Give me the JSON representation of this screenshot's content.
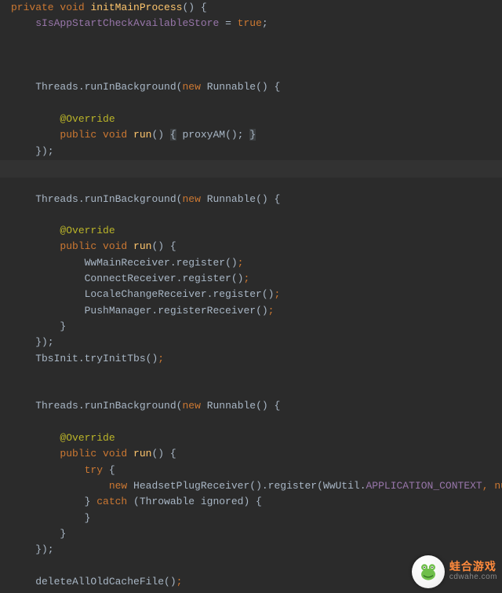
{
  "code_lines": [
    [
      {
        "t": "private ",
        "c": "kw"
      },
      {
        "t": "void ",
        "c": "kw"
      },
      {
        "t": "initMainProcess",
        "c": "meth"
      },
      {
        "t": "() {",
        "c": ""
      }
    ],
    [
      {
        "t": "    ",
        "c": ""
      },
      {
        "t": "sIsAppStartCheckAvailableStore",
        "c": "st"
      },
      {
        "t": " = ",
        "c": ""
      },
      {
        "t": "true",
        "c": "lit"
      },
      {
        "t": ";",
        "c": ""
      }
    ],
    [],
    [],
    [],
    [
      {
        "t": "    Threads.",
        "c": ""
      },
      {
        "t": "runInBackground",
        "c": ""
      },
      {
        "t": "(",
        "c": ""
      },
      {
        "t": "new ",
        "c": "kw"
      },
      {
        "t": "Runnable() {",
        "c": ""
      }
    ],
    [],
    [
      {
        "t": "        ",
        "c": ""
      },
      {
        "t": "@Override",
        "c": "ann"
      }
    ],
    [
      {
        "t": "        ",
        "c": ""
      },
      {
        "t": "public ",
        "c": "kw"
      },
      {
        "t": "void ",
        "c": "kw"
      },
      {
        "t": "run",
        "c": "meth"
      },
      {
        "t": "() ",
        "c": ""
      },
      {
        "t": "{",
        "c": "hl"
      },
      {
        "t": " proxyAM(); ",
        "c": ""
      },
      {
        "t": "}",
        "c": "hl"
      }
    ],
    [
      {
        "t": "    });",
        "c": ""
      }
    ],
    [],
    [],
    [
      {
        "t": "    Threads.",
        "c": ""
      },
      {
        "t": "runInBackground",
        "c": ""
      },
      {
        "t": "(",
        "c": ""
      },
      {
        "t": "new ",
        "c": "kw"
      },
      {
        "t": "Runnable() {",
        "c": ""
      }
    ],
    [],
    [
      {
        "t": "        ",
        "c": ""
      },
      {
        "t": "@Override",
        "c": "ann"
      }
    ],
    [
      {
        "t": "        ",
        "c": ""
      },
      {
        "t": "public ",
        "c": "kw"
      },
      {
        "t": "void ",
        "c": "kw"
      },
      {
        "t": "run",
        "c": "meth"
      },
      {
        "t": "() {",
        "c": ""
      }
    ],
    [
      {
        "t": "            WwMainReceiver.",
        "c": ""
      },
      {
        "t": "register",
        "c": ""
      },
      {
        "t": "()",
        "c": ""
      },
      {
        "t": ";",
        "c": "kw"
      }
    ],
    [
      {
        "t": "            ConnectReceiver.",
        "c": ""
      },
      {
        "t": "register",
        "c": ""
      },
      {
        "t": "()",
        "c": ""
      },
      {
        "t": ";",
        "c": "kw"
      }
    ],
    [
      {
        "t": "            LocaleChangeReceiver.",
        "c": ""
      },
      {
        "t": "register",
        "c": ""
      },
      {
        "t": "()",
        "c": ""
      },
      {
        "t": ";",
        "c": "kw"
      }
    ],
    [
      {
        "t": "            PushManager.",
        "c": ""
      },
      {
        "t": "registerReceiver",
        "c": ""
      },
      {
        "t": "()",
        "c": ""
      },
      {
        "t": ";",
        "c": "kw"
      }
    ],
    [
      {
        "t": "        }",
        "c": ""
      }
    ],
    [
      {
        "t": "    });",
        "c": ""
      }
    ],
    [
      {
        "t": "    TbsInit.",
        "c": ""
      },
      {
        "t": "tryInitTbs",
        "c": ""
      },
      {
        "t": "()",
        "c": ""
      },
      {
        "t": ";",
        "c": "kw"
      }
    ],
    [],
    [],
    [
      {
        "t": "    Threads.",
        "c": ""
      },
      {
        "t": "runInBackground",
        "c": ""
      },
      {
        "t": "(",
        "c": ""
      },
      {
        "t": "new ",
        "c": "kw"
      },
      {
        "t": "Runnable() {",
        "c": ""
      }
    ],
    [],
    [
      {
        "t": "        ",
        "c": ""
      },
      {
        "t": "@Override",
        "c": "ann"
      }
    ],
    [
      {
        "t": "        ",
        "c": ""
      },
      {
        "t": "public ",
        "c": "kw"
      },
      {
        "t": "void ",
        "c": "kw"
      },
      {
        "t": "run",
        "c": "meth"
      },
      {
        "t": "() {",
        "c": ""
      }
    ],
    [
      {
        "t": "            ",
        "c": ""
      },
      {
        "t": "try ",
        "c": "kw"
      },
      {
        "t": "{",
        "c": ""
      }
    ],
    [
      {
        "t": "                ",
        "c": ""
      },
      {
        "t": "new ",
        "c": "kw"
      },
      {
        "t": "HeadsetPlugReceiver().register(WwUtil.",
        "c": ""
      },
      {
        "t": "APPLICATION_CONTEXT",
        "c": "st"
      },
      {
        "t": ", ",
        "c": "kw"
      },
      {
        "t": "null",
        "c": "lit"
      },
      {
        "t": ")",
        "c": ""
      },
      {
        "t": ";",
        "c": "kw"
      }
    ],
    [
      {
        "t": "            } ",
        "c": ""
      },
      {
        "t": "catch ",
        "c": "kw"
      },
      {
        "t": "(Throwable ignored) {",
        "c": ""
      }
    ],
    [
      {
        "t": "            }",
        "c": ""
      }
    ],
    [
      {
        "t": "        }",
        "c": ""
      }
    ],
    [
      {
        "t": "    });",
        "c": ""
      }
    ],
    [],
    [
      {
        "t": "    deleteAllOldCacheFile()",
        "c": ""
      },
      {
        "t": ";",
        "c": "kw"
      }
    ]
  ],
  "watermark": {
    "title": "蛙合游戏",
    "url": "cdwahe.com"
  }
}
